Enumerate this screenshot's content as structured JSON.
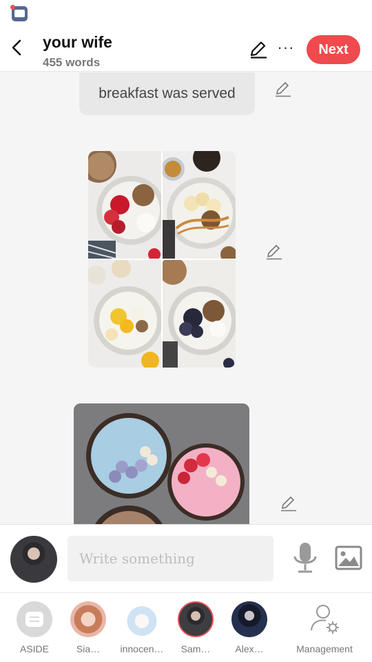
{
  "header": {
    "title": "your wife",
    "word_count": "455 words",
    "next_label": "Next",
    "more_label": "···"
  },
  "chat": {
    "text_message": "breakfast was served",
    "image_message_1": "four breakfast yogurt bowls with fruit and granola",
    "image_message_2": "smoothie bowls with blueberries, banana and strawberries"
  },
  "composer": {
    "placeholder": "Write something"
  },
  "tabs": [
    {
      "label": "ASIDE"
    },
    {
      "label": "Sia…"
    },
    {
      "label": "innocen…"
    },
    {
      "label": "Sam…"
    },
    {
      "label": "Alex…"
    },
    {
      "label": "Management"
    }
  ],
  "colors": {
    "accent": "#ef4a4d",
    "selected_ring": "#e25555"
  }
}
